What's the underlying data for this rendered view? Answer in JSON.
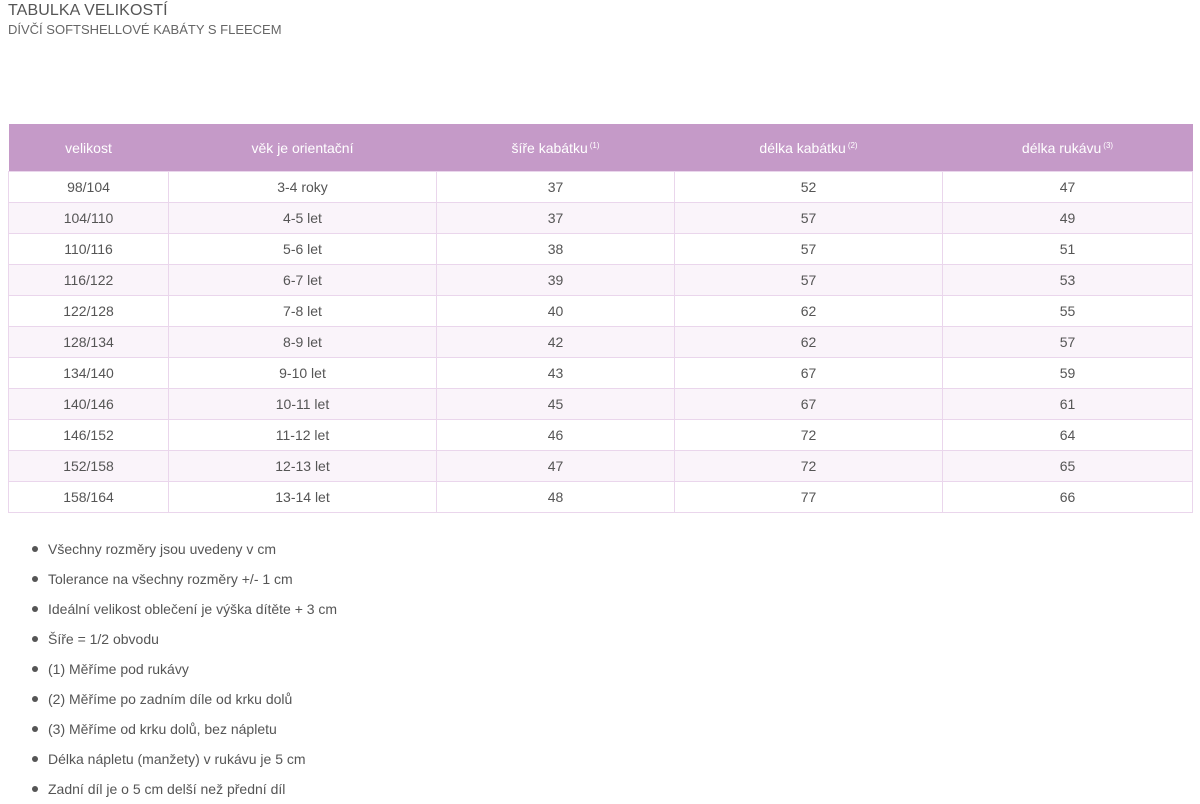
{
  "header": {
    "title": "TABULKA VELIKOSTÍ",
    "subtitle": "DÍVČÍ SOFTSHELLOVÉ KABÁTY S FLEECEM"
  },
  "table": {
    "columns": [
      {
        "label": "velikost",
        "sup": ""
      },
      {
        "label": "věk je orientační",
        "sup": ""
      },
      {
        "label": "šíře kabátku",
        "sup": "(1)"
      },
      {
        "label": "délka kabátku",
        "sup": "(2)"
      },
      {
        "label": "délka rukávu",
        "sup": "(3)"
      }
    ],
    "rows": [
      [
        "98/104",
        "3-4 roky",
        "37",
        "52",
        "47"
      ],
      [
        "104/110",
        "4-5 let",
        "37",
        "57",
        "49"
      ],
      [
        "110/116",
        "5-6 let",
        "38",
        "57",
        "51"
      ],
      [
        "116/122",
        "6-7 let",
        "39",
        "57",
        "53"
      ],
      [
        "122/128",
        "7-8 let",
        "40",
        "62",
        "55"
      ],
      [
        "128/134",
        "8-9 let",
        "42",
        "62",
        "57"
      ],
      [
        "134/140",
        "9-10 let",
        "43",
        "67",
        "59"
      ],
      [
        "140/146",
        "10-11 let",
        "45",
        "67",
        "61"
      ],
      [
        "146/152",
        "11-12 let",
        "46",
        "72",
        "64"
      ],
      [
        "152/158",
        "12-13 let",
        "47",
        "72",
        "65"
      ],
      [
        "158/164",
        "13-14 let",
        "48",
        "77",
        "66"
      ]
    ]
  },
  "notes": [
    "Všechny rozměry jsou uvedeny v cm",
    "Tolerance na všechny rozměry +/- 1 cm",
    "Ideální velikost oblečení je výška dítěte + 3 cm",
    "Šíře = 1/2 obvodu",
    "(1) Měříme pod rukávy",
    "(2) Měříme po zadním díle od krku dolů",
    "(3) Měříme od krku dolů, bez nápletu",
    "Délka nápletu (manžety) v rukávu je 5 cm",
    "Zadní díl je o 5 cm delší než přední díl"
  ],
  "colors": {
    "header_background": "#c59ac8",
    "header_text": "#ffffff",
    "row_border": "#ead6ec",
    "row_alt_background": "#faf4fa"
  }
}
